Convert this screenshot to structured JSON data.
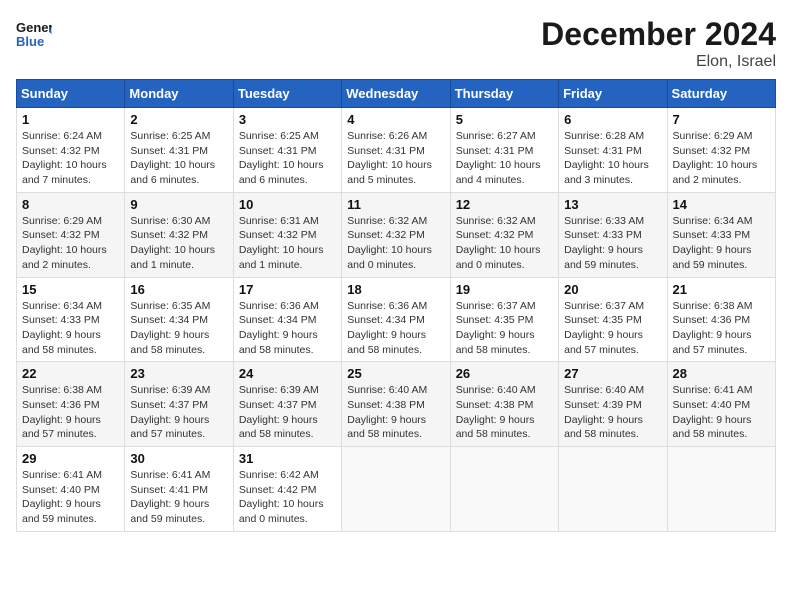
{
  "header": {
    "logo_general": "General",
    "logo_blue": "Blue",
    "month": "December 2024",
    "location": "Elon, Israel"
  },
  "days_of_week": [
    "Sunday",
    "Monday",
    "Tuesday",
    "Wednesday",
    "Thursday",
    "Friday",
    "Saturday"
  ],
  "weeks": [
    [
      {
        "day": "1",
        "sunrise": "6:24 AM",
        "sunset": "4:32 PM",
        "daylight": "10 hours and 7 minutes."
      },
      {
        "day": "2",
        "sunrise": "6:25 AM",
        "sunset": "4:31 PM",
        "daylight": "10 hours and 6 minutes."
      },
      {
        "day": "3",
        "sunrise": "6:25 AM",
        "sunset": "4:31 PM",
        "daylight": "10 hours and 6 minutes."
      },
      {
        "day": "4",
        "sunrise": "6:26 AM",
        "sunset": "4:31 PM",
        "daylight": "10 hours and 5 minutes."
      },
      {
        "day": "5",
        "sunrise": "6:27 AM",
        "sunset": "4:31 PM",
        "daylight": "10 hours and 4 minutes."
      },
      {
        "day": "6",
        "sunrise": "6:28 AM",
        "sunset": "4:31 PM",
        "daylight": "10 hours and 3 minutes."
      },
      {
        "day": "7",
        "sunrise": "6:29 AM",
        "sunset": "4:32 PM",
        "daylight": "10 hours and 2 minutes."
      }
    ],
    [
      {
        "day": "8",
        "sunrise": "6:29 AM",
        "sunset": "4:32 PM",
        "daylight": "10 hours and 2 minutes."
      },
      {
        "day": "9",
        "sunrise": "6:30 AM",
        "sunset": "4:32 PM",
        "daylight": "10 hours and 1 minute."
      },
      {
        "day": "10",
        "sunrise": "6:31 AM",
        "sunset": "4:32 PM",
        "daylight": "10 hours and 1 minute."
      },
      {
        "day": "11",
        "sunrise": "6:32 AM",
        "sunset": "4:32 PM",
        "daylight": "10 hours and 0 minutes."
      },
      {
        "day": "12",
        "sunrise": "6:32 AM",
        "sunset": "4:32 PM",
        "daylight": "10 hours and 0 minutes."
      },
      {
        "day": "13",
        "sunrise": "6:33 AM",
        "sunset": "4:33 PM",
        "daylight": "9 hours and 59 minutes."
      },
      {
        "day": "14",
        "sunrise": "6:34 AM",
        "sunset": "4:33 PM",
        "daylight": "9 hours and 59 minutes."
      }
    ],
    [
      {
        "day": "15",
        "sunrise": "6:34 AM",
        "sunset": "4:33 PM",
        "daylight": "9 hours and 58 minutes."
      },
      {
        "day": "16",
        "sunrise": "6:35 AM",
        "sunset": "4:34 PM",
        "daylight": "9 hours and 58 minutes."
      },
      {
        "day": "17",
        "sunrise": "6:36 AM",
        "sunset": "4:34 PM",
        "daylight": "9 hours and 58 minutes."
      },
      {
        "day": "18",
        "sunrise": "6:36 AM",
        "sunset": "4:34 PM",
        "daylight": "9 hours and 58 minutes."
      },
      {
        "day": "19",
        "sunrise": "6:37 AM",
        "sunset": "4:35 PM",
        "daylight": "9 hours and 58 minutes."
      },
      {
        "day": "20",
        "sunrise": "6:37 AM",
        "sunset": "4:35 PM",
        "daylight": "9 hours and 57 minutes."
      },
      {
        "day": "21",
        "sunrise": "6:38 AM",
        "sunset": "4:36 PM",
        "daylight": "9 hours and 57 minutes."
      }
    ],
    [
      {
        "day": "22",
        "sunrise": "6:38 AM",
        "sunset": "4:36 PM",
        "daylight": "9 hours and 57 minutes."
      },
      {
        "day": "23",
        "sunrise": "6:39 AM",
        "sunset": "4:37 PM",
        "daylight": "9 hours and 57 minutes."
      },
      {
        "day": "24",
        "sunrise": "6:39 AM",
        "sunset": "4:37 PM",
        "daylight": "9 hours and 58 minutes."
      },
      {
        "day": "25",
        "sunrise": "6:40 AM",
        "sunset": "4:38 PM",
        "daylight": "9 hours and 58 minutes."
      },
      {
        "day": "26",
        "sunrise": "6:40 AM",
        "sunset": "4:38 PM",
        "daylight": "9 hours and 58 minutes."
      },
      {
        "day": "27",
        "sunrise": "6:40 AM",
        "sunset": "4:39 PM",
        "daylight": "9 hours and 58 minutes."
      },
      {
        "day": "28",
        "sunrise": "6:41 AM",
        "sunset": "4:40 PM",
        "daylight": "9 hours and 58 minutes."
      }
    ],
    [
      {
        "day": "29",
        "sunrise": "6:41 AM",
        "sunset": "4:40 PM",
        "daylight": "9 hours and 59 minutes."
      },
      {
        "day": "30",
        "sunrise": "6:41 AM",
        "sunset": "4:41 PM",
        "daylight": "9 hours and 59 minutes."
      },
      {
        "day": "31",
        "sunrise": "6:42 AM",
        "sunset": "4:42 PM",
        "daylight": "10 hours and 0 minutes."
      },
      null,
      null,
      null,
      null
    ]
  ]
}
